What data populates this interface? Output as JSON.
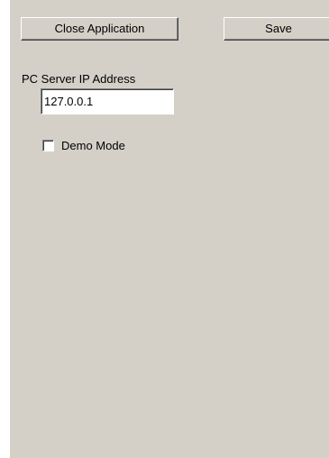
{
  "toolbar": {
    "close_label": "Close Application",
    "save_label": "Save"
  },
  "server": {
    "ip_label": "PC Server IP Address",
    "ip_value": "127.0.0.1"
  },
  "options": {
    "demo_mode_label": "Demo Mode",
    "demo_mode_checked": false
  },
  "colors": {
    "panel_background": "#d4d0c8",
    "input_background": "#ffffff"
  }
}
